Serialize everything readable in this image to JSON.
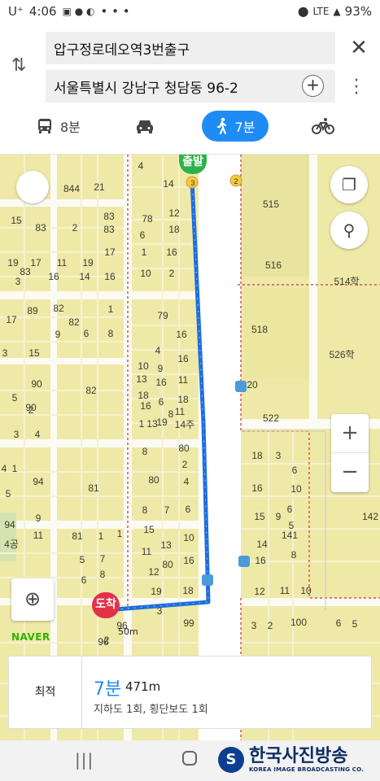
{
  "statusbar": {
    "time": "4:06",
    "carrier": "U⁺",
    "dots": "• • •",
    "lte": "LTE",
    "battery": "93%"
  },
  "search": {
    "origin": "압구정로데오역3번출구",
    "destination": "서울특별시 강남구 청담동 96-2"
  },
  "modes": [
    {
      "icon": "bus-icon",
      "label": "8분"
    },
    {
      "icon": "car-icon",
      "label": ""
    },
    {
      "icon": "walk-icon",
      "label": "7분",
      "selected": true
    },
    {
      "icon": "bike-icon",
      "label": ""
    }
  ],
  "map": {
    "start_label": "출발",
    "end_label": "도착",
    "brand": "NAVER",
    "scale": "50m",
    "block_numbers": [
      "4",
      "14",
      "3",
      "2",
      "515",
      "516",
      "514학",
      "518",
      "526학",
      "20",
      "522",
      "78",
      "18",
      "83",
      "844",
      "21",
      "15",
      "83",
      "2",
      "83",
      "6",
      "16",
      "19",
      "17",
      "11",
      "19",
      "83",
      "16",
      "14",
      "17",
      "16",
      "3",
      "1",
      "10",
      "2",
      "12",
      "79",
      "89",
      "17",
      "82",
      "1",
      "8",
      "16",
      "9",
      "3",
      "15",
      "82",
      "6",
      "4",
      "9",
      "16",
      "10",
      "11",
      "13",
      "16",
      "18",
      "6",
      "11",
      "18",
      "19",
      "16",
      "8",
      "1",
      "13",
      "14주",
      "90",
      "82",
      "2",
      "4",
      "3",
      "15",
      "18",
      "80",
      "81",
      "94",
      "8",
      "6",
      "4",
      "1",
      "5",
      "18",
      "6",
      "10",
      "12",
      "14",
      "16",
      "142",
      "15",
      "11",
      "13",
      "10",
      "12",
      "9",
      "12",
      "94",
      "81",
      "1",
      "19",
      "18",
      "3",
      "80",
      "100",
      "99",
      "96",
      "7",
      "8",
      "4공",
      "6",
      "141",
      "5"
    ]
  },
  "card": {
    "option": "최적",
    "time": "7분",
    "distance": "471m",
    "detail": "지하도 1회, 횡단보도 1회"
  },
  "watermark": {
    "title": "한국사진방송",
    "subtitle": "KOREA IMAGE BROADCASTING CO."
  },
  "colors": {
    "accent": "#1f8cf5",
    "map_bg": "#efe9a8",
    "route": "#1d6de0",
    "start": "#2db24a",
    "end": "#e5304a"
  }
}
